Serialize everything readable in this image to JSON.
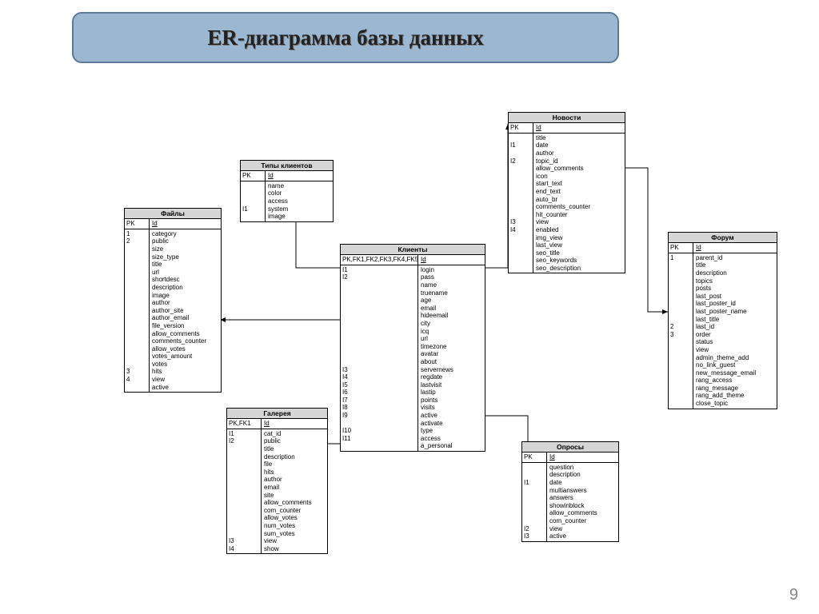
{
  "header": {
    "title": "ER-диаграмма базы данных"
  },
  "page_number": "9",
  "entities": {
    "types": {
      "title": "Типы клиентов",
      "pk_keys": "PK",
      "pk_field": "Id",
      "body_keys": [
        "",
        "",
        "",
        "I1",
        ""
      ],
      "body_fields": [
        "name",
        "color",
        "access",
        "system",
        "image"
      ]
    },
    "files": {
      "title": "Файлы",
      "pk_keys": "PK",
      "pk_field": "Id",
      "body_keys": [
        "1",
        "2",
        "",
        "",
        "",
        "",
        "",
        "",
        "",
        "",
        "",
        "",
        "",
        "",
        "",
        "",
        "",
        "",
        "3",
        "4"
      ],
      "body_fields": [
        "category",
        "public",
        "size",
        "size_type",
        "title",
        "url",
        "shortdesc",
        "description",
        "image",
        "author",
        "author_site",
        "author_email",
        "file_version",
        "allow_comments",
        "comments_counter",
        "allow_votes",
        "votes_amount",
        "votes",
        "hits",
        "view",
        "active"
      ]
    },
    "clients": {
      "title": "Клиенты",
      "pk_keys": "PK,FK1,FK2,FK3,FK4,FK5",
      "pk_field": "Id",
      "body_keys": [
        "I1",
        "I2",
        "",
        "",
        "",
        "",
        "",
        "",
        "",
        "",
        "",
        "",
        "",
        "I3",
        "I4",
        "I5",
        "I6",
        "I7",
        "I8",
        "I9",
        "",
        "I10",
        "I11",
        ""
      ],
      "body_fields": [
        "login",
        "pass",
        "name",
        "truename",
        "age",
        "email",
        "hideemail",
        "city",
        "icq",
        "url",
        "timezone",
        "avatar",
        "about",
        "servernews",
        "regdate",
        "lastvisit",
        "lastip",
        "points",
        "visits",
        "active",
        "activate",
        "type",
        "access",
        "a_personal"
      ]
    },
    "news": {
      "title": "Новости",
      "pk_keys": "PK",
      "pk_field": "Id",
      "body_keys": [
        "",
        "I1",
        "",
        "I2",
        "",
        "",
        "",
        "",
        "",
        "",
        "",
        "I3",
        "I4",
        "",
        "",
        "",
        "",
        ""
      ],
      "body_fields": [
        "title",
        "date",
        "author",
        "topic_id",
        "allow_comments",
        "icon",
        "start_text",
        "end_text",
        "auto_br",
        "comments_counter",
        "hit_counter",
        "view",
        "enabled",
        "img_view",
        "last_view",
        "seo_title",
        "seo_keywords",
        "seo_description"
      ]
    },
    "forum": {
      "title": "Форум",
      "pk_keys": "PK",
      "pk_field": "Id",
      "body_keys": [
        "1",
        "",
        "",
        "",
        "",
        "",
        "",
        "",
        "",
        "2",
        "3",
        "",
        "",
        "",
        "",
        "",
        "",
        "",
        ""
      ],
      "body_fields": [
        "parent_id",
        "title",
        "description",
        "topics",
        "posts",
        "last_post",
        "last_poster_id",
        "last_poster_name",
        "last_title",
        "last_id",
        "order",
        "status",
        "view",
        "admin_theme_add",
        "no_link_guest",
        "new_message_email",
        "rang_access",
        "rang_message",
        "rang_add_theme",
        "close_topic"
      ]
    },
    "gallery": {
      "title": "Галерея",
      "pk_keys": "PK,FK1",
      "pk_field": "Id",
      "body_keys": [
        "I1",
        "I2",
        "",
        "",
        "",
        "",
        "",
        "",
        "",
        "",
        "",
        "",
        "",
        "",
        "I3",
        "I4"
      ],
      "body_fields": [
        "cat_id",
        "public",
        "title",
        "description",
        "file",
        "hits",
        "author",
        "email",
        "site",
        "allow_comments",
        "com_counter",
        "allow_votes",
        "num_votes",
        "sum_votes",
        "view",
        "show"
      ]
    },
    "polls": {
      "title": "Опросы",
      "pk_keys": "PK",
      "pk_field": "Id",
      "body_keys": [
        "",
        "",
        "I1",
        "",
        "",
        "",
        "",
        "",
        "I2",
        "I3"
      ],
      "body_fields": [
        "question",
        "description",
        "date",
        "multianswers",
        "answers",
        "showinblock",
        "allow_comments",
        "com_counter",
        "view",
        "active"
      ]
    }
  }
}
